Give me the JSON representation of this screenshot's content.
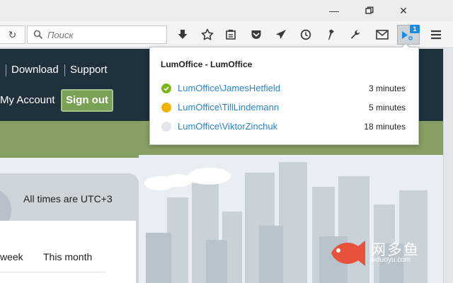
{
  "window": {
    "minimize_glyph": "—",
    "maximize_glyph": "❐",
    "close_glyph": "✕"
  },
  "toolbar": {
    "reload_glyph": "↻",
    "search_placeholder": "Поиск",
    "icons": [
      "download-icon",
      "bookmark-star-icon",
      "reader-view-icon",
      "pocket-icon",
      "send-icon",
      "clock-icon",
      "pin-icon",
      "wrench-icon",
      "mail-icon",
      "extension-chat-icon",
      "hamburger-menu-icon"
    ],
    "extension_badge": "1"
  },
  "site_nav": {
    "download_label": "Download",
    "support_label": "Support",
    "my_account_label": "My Account",
    "sign_out_label": "Sign out"
  },
  "content": {
    "timezone_note": "All times are UTC+3",
    "col_week": "week",
    "col_month": "This month"
  },
  "watermark": {
    "text": "网多鱼",
    "sub": "wduoyu.com"
  },
  "popup": {
    "title": "LumOffice - LumOffice",
    "users": [
      {
        "name": "LumOffice\\JamesHetfield",
        "time": "3 minutes",
        "status": "online",
        "color": "#7cb518"
      },
      {
        "name": "LumOffice\\TillLindemann",
        "time": "5 minutes",
        "status": "away",
        "color": "#f0b400"
      },
      {
        "name": "LumOffice\\ViktorZinchuk",
        "time": "18 minutes",
        "status": "offline",
        "color": "#e3e6ea"
      }
    ]
  },
  "colors": {
    "nav_bg": "#1e313c",
    "accent_green": "#7aa155",
    "link_blue": "#2a86c7",
    "badge_blue": "#1a8ce0"
  }
}
